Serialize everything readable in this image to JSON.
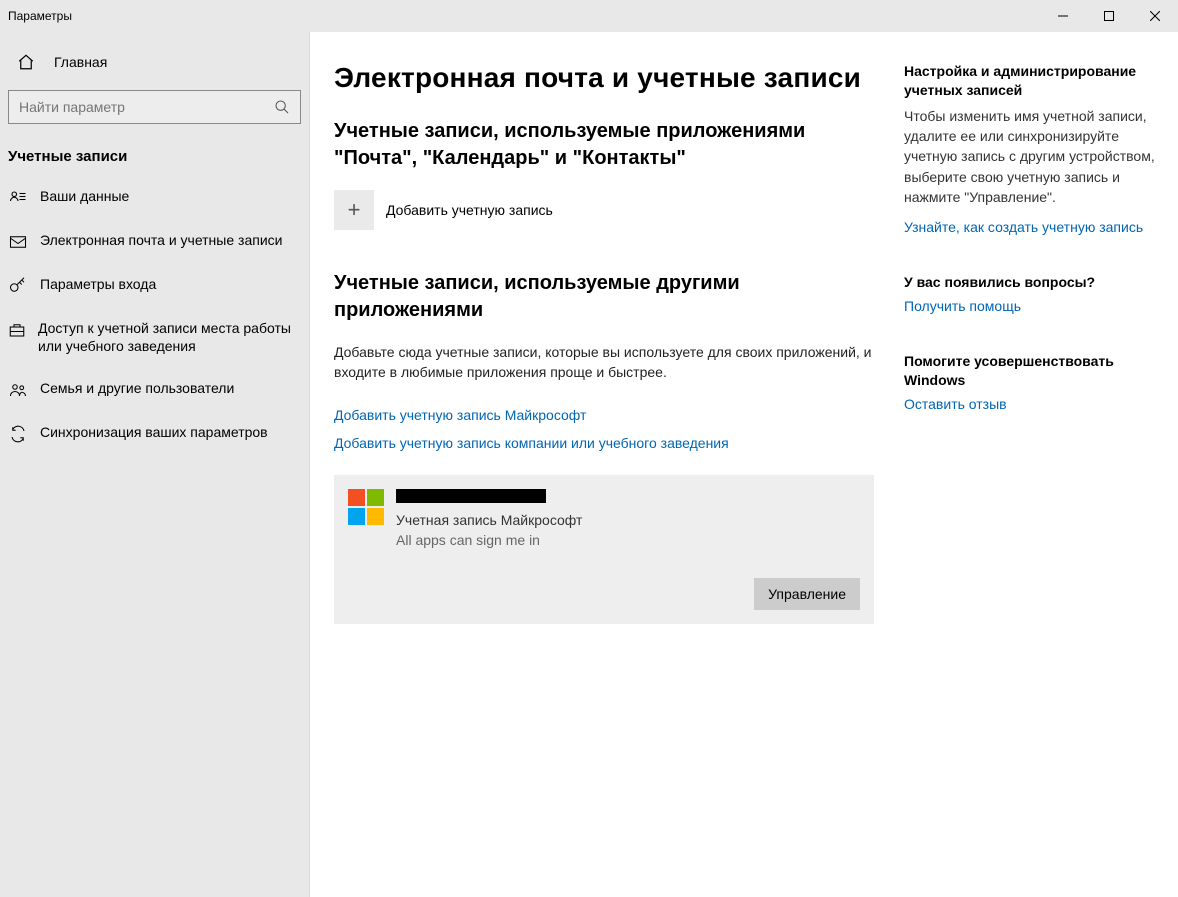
{
  "window": {
    "title": "Параметры"
  },
  "sidebar": {
    "home": "Главная",
    "search_placeholder": "Найти параметр",
    "section": "Учетные записи",
    "items": [
      {
        "label": "Ваши данные"
      },
      {
        "label": "Электронная почта и учетные записи"
      },
      {
        "label": "Параметры входа"
      },
      {
        "label": "Доступ к учетной записи места работы или учебного заведения"
      },
      {
        "label": "Семья и другие пользователи"
      },
      {
        "label": "Синхронизация ваших параметров"
      }
    ]
  },
  "main": {
    "page_title": "Электронная почта и учетные записи",
    "section1_title": "Учетные записи, используемые приложениями \"Почта\", \"Календарь\" и \"Контакты\"",
    "add_account_label": "Добавить учетную запись",
    "section2_title": "Учетные записи, используемые другими приложениями",
    "section2_desc": "Добавьте сюда учетные записи, которые вы используете для своих приложений, и входите в любимые приложения проще и быстрее.",
    "link_ms": "Добавить учетную запись Майкрософт",
    "link_org": "Добавить учетную запись компании или учебного заведения",
    "account": {
      "type_label": "Учетная запись Майкрософт",
      "status": "All apps can sign me in",
      "manage_btn": "Управление"
    }
  },
  "aside": {
    "block1_title": "Настройка и администрирование учетных записей",
    "block1_body": "Чтобы изменить имя учетной записи, удалите ее или синхронизируйте учетную запись с другим устройством, выберите свою учетную запись и нажмите \"Управление\".",
    "block1_link": "Узнайте, как создать учетную запись",
    "block2_title": "У вас появились вопросы?",
    "block2_link": "Получить помощь",
    "block3_title": "Помогите усовершенствовать Windows",
    "block3_link": "Оставить отзыв"
  }
}
